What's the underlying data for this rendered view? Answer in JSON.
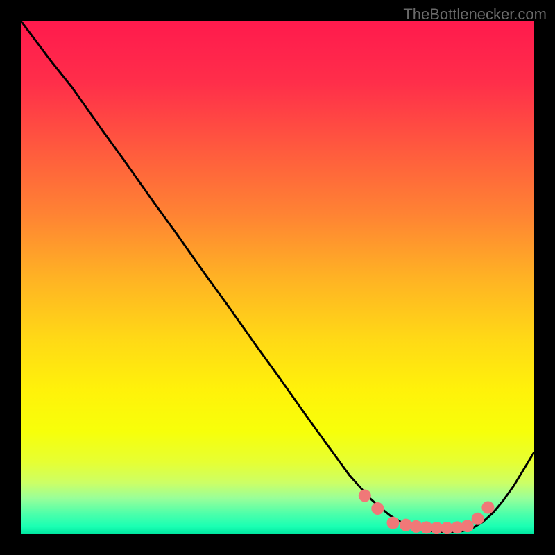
{
  "watermark": "TheBottlenecker.com",
  "chart_data": {
    "type": "line",
    "title": "",
    "xlabel": "",
    "ylabel": "",
    "xlim": [
      0,
      100
    ],
    "ylim": [
      0,
      100
    ],
    "grid": false,
    "series": [
      {
        "name": "curve",
        "x": [
          0,
          6,
          10,
          16,
          20,
          26,
          30,
          36,
          40,
          46,
          50,
          56,
          60,
          64,
          68,
          70,
          72,
          74,
          76,
          78,
          80,
          82,
          84,
          86,
          88,
          90,
          92,
          94,
          96,
          100
        ],
        "values": [
          100,
          92,
          87,
          78.5,
          73,
          64.5,
          59,
          50.5,
          45,
          36.5,
          31,
          22.5,
          17,
          11.5,
          7,
          5.2,
          3.6,
          2.4,
          1.6,
          1.0,
          0.6,
          0.4,
          0.4,
          0.6,
          1.2,
          2.4,
          4.2,
          6.6,
          9.4,
          16
        ]
      }
    ],
    "markers": {
      "name": "dots",
      "x": [
        67,
        69.5,
        72.5,
        75,
        77,
        79,
        81,
        83,
        85,
        87,
        89,
        91
      ],
      "values": [
        7.5,
        5.0,
        2.2,
        1.8,
        1.5,
        1.3,
        1.2,
        1.2,
        1.3,
        1.6,
        3.0,
        5.2
      ],
      "color": "#f07878",
      "radius": 9
    },
    "background_gradient": {
      "stops": [
        {
          "offset": 0.0,
          "color": "#ff1a4d"
        },
        {
          "offset": 0.12,
          "color": "#ff2e4a"
        },
        {
          "offset": 0.25,
          "color": "#ff5a3e"
        },
        {
          "offset": 0.38,
          "color": "#ff8433"
        },
        {
          "offset": 0.5,
          "color": "#ffb224"
        },
        {
          "offset": 0.62,
          "color": "#ffd916"
        },
        {
          "offset": 0.72,
          "color": "#fff20a"
        },
        {
          "offset": 0.8,
          "color": "#f7ff0a"
        },
        {
          "offset": 0.86,
          "color": "#e6ff33"
        },
        {
          "offset": 0.9,
          "color": "#ccff66"
        },
        {
          "offset": 0.93,
          "color": "#99ff99"
        },
        {
          "offset": 0.96,
          "color": "#4dffaa"
        },
        {
          "offset": 0.985,
          "color": "#1affb3"
        },
        {
          "offset": 1.0,
          "color": "#00e6a0"
        }
      ]
    }
  }
}
